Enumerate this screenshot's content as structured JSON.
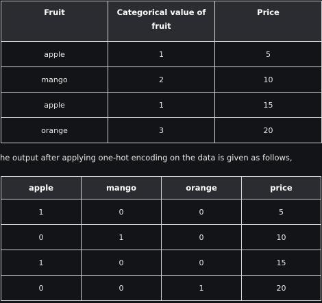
{
  "table1": {
    "headers": [
      "Fruit",
      "Categorical value of fruit",
      "Price"
    ],
    "rows": [
      [
        "apple",
        "1",
        "5"
      ],
      [
        "mango",
        "2",
        "10"
      ],
      [
        "apple",
        "1",
        "15"
      ],
      [
        "orange",
        "3",
        "20"
      ]
    ]
  },
  "sentence": "he output after applying one-hot encoding on the data is given as follows,",
  "table2": {
    "headers": [
      "apple",
      "mango",
      "orange",
      "price"
    ],
    "rows": [
      [
        "1",
        "0",
        "0",
        "5"
      ],
      [
        "0",
        "1",
        "0",
        "10"
      ],
      [
        "1",
        "0",
        "0",
        "15"
      ],
      [
        "0",
        "0",
        "1",
        "20"
      ]
    ]
  }
}
